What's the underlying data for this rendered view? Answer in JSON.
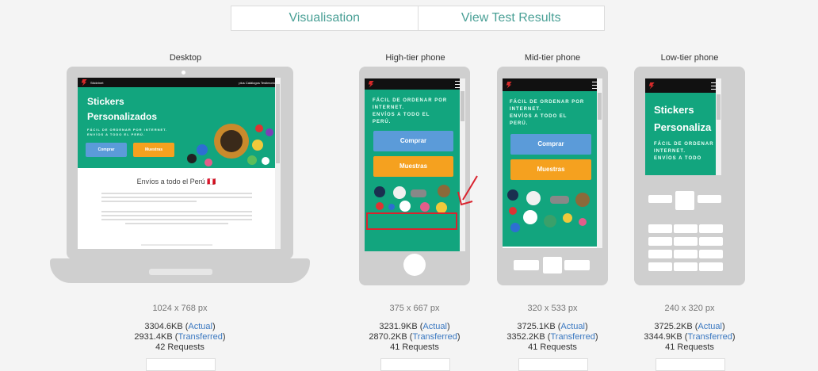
{
  "tabs": [
    {
      "label": "Visualisation"
    },
    {
      "label": "View Test Results"
    }
  ],
  "devices": [
    {
      "name": "Desktop",
      "resolution": "1024 x 768 px",
      "actual": "3304.6KB",
      "transferred": "2931.4KB",
      "requests": "42 Requests"
    },
    {
      "name": "High-tier phone",
      "resolution": "375 x 667 px",
      "actual": "3231.9KB",
      "transferred": "2870.2KB",
      "requests": "41 Requests"
    },
    {
      "name": "Mid-tier phone",
      "resolution": "320 x 533 px",
      "actual": "3725.1KB",
      "transferred": "3352.2KB",
      "requests": "41 Requests"
    },
    {
      "name": "Low-tier phone",
      "resolution": "240 x 320 px",
      "actual": "3725.2KB",
      "transferred": "3344.9KB",
      "requests": "41 Requests"
    }
  ],
  "labels": {
    "actual": "Actual",
    "transferred": "Transferred"
  },
  "site": {
    "title_line1": "Stickers",
    "title_line2": "Personalizados",
    "title_line2_low": "Personaliza",
    "tagline": "FÁCIL DE ORDENAR POR INTERNET. ENVÍOS A TODO EL PERÚ.",
    "tagline_l1": "FÁCIL DE ORDENAR POR",
    "tagline_l2": "INTERNET.",
    "tagline_l3": "ENVÍOS A TODO EL",
    "tagline_l4": "PERÚ.",
    "low_l1": "FÁCIL DE ORDENAR POR",
    "low_l2": "INTERNET.",
    "low_l3": "ENVÍOS A TODO",
    "btn_buy": "Comprar",
    "btn_samples": "Muestras",
    "section_title": "Envíos a todo el Perú 🇵🇪",
    "nav_brand": "Stickrinet",
    "nav_links": "plus  Catálogos  Testimonios"
  },
  "colors": {
    "accent": "#4aa096",
    "site_green": "#12a57e",
    "link": "#3a78c1",
    "highlight": "#d9232e"
  }
}
